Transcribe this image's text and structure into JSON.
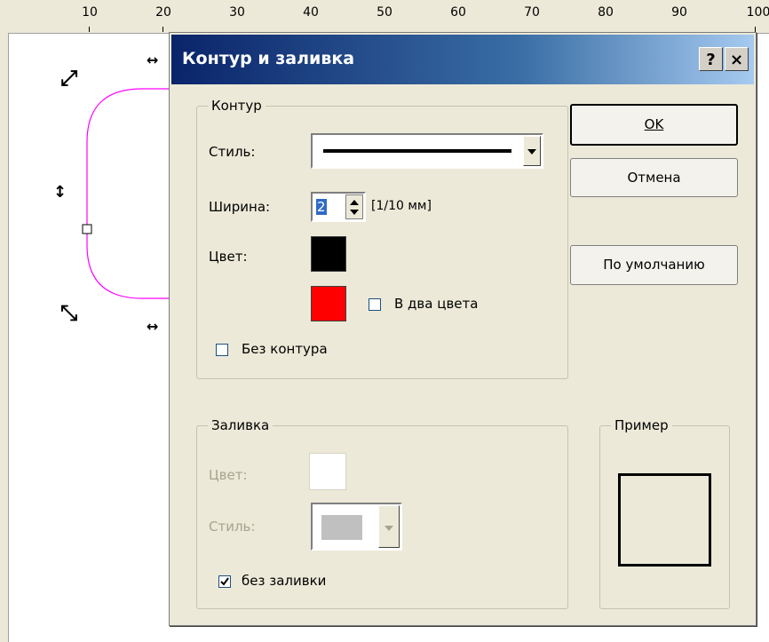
{
  "ruler": {
    "ticks": [
      "10",
      "20",
      "30",
      "40",
      "50",
      "60",
      "70",
      "80",
      "90",
      "100"
    ]
  },
  "canvas": {
    "shape_color": "#ff00ff"
  },
  "dialog": {
    "title": "Контур и заливка",
    "help_label": "?",
    "close_label": "×",
    "outline_group": {
      "title": "Контур",
      "style_label": "Стиль:",
      "width_label": "Ширина:",
      "width_value": "2",
      "width_unit": "[1/10 мм]",
      "color_label": "Цвет:",
      "color1": "#000000",
      "color2": "#ff0000",
      "two_colors_label": "В два цвета",
      "two_colors_checked": false,
      "no_outline_label": "Без контура",
      "no_outline_checked": false
    },
    "fill_group": {
      "title": "Заливка",
      "color_label": "Цвет:",
      "style_label": "Стиль:",
      "no_fill_label": "без заливки",
      "no_fill_checked": true,
      "color": "#ffffff",
      "style_color": "#c0c0c0"
    },
    "preview_group": {
      "title": "Пример"
    },
    "buttons": {
      "ok": "OK",
      "cancel": "Отмена",
      "default": "По умолчанию"
    }
  }
}
